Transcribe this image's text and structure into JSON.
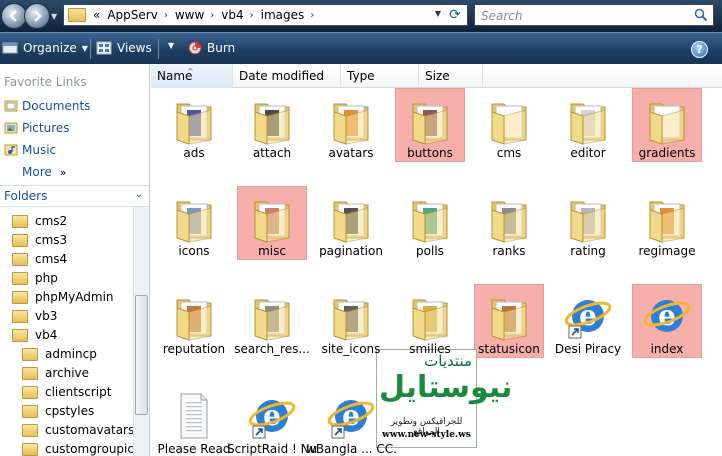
{
  "address": {
    "overflow": "«",
    "path": [
      "AppServ",
      "www",
      "vb4",
      "images"
    ]
  },
  "search": {
    "placeholder": "Search"
  },
  "commandbar": {
    "organize": "Organize",
    "views": "Views",
    "burn": "Burn",
    "help": "?"
  },
  "left": {
    "favorites_header": "Favorite Links",
    "favorites": [
      "Documents",
      "Pictures",
      "Music"
    ],
    "more": "More",
    "folders_header": "Folders",
    "tree": [
      {
        "label": "cms2",
        "level": 1
      },
      {
        "label": "cms3",
        "level": 1
      },
      {
        "label": "cms4",
        "level": 1
      },
      {
        "label": "php",
        "level": 1
      },
      {
        "label": "phpMyAdmin",
        "level": 1
      },
      {
        "label": "vb3",
        "level": 1
      },
      {
        "label": "vb4",
        "level": 1
      },
      {
        "label": "admincp",
        "level": 2
      },
      {
        "label": "archive",
        "level": 2
      },
      {
        "label": "clientscript",
        "level": 2
      },
      {
        "label": "cpstyles",
        "level": 2
      },
      {
        "label": "customavatars",
        "level": 2
      },
      {
        "label": "customgroupico",
        "level": 2
      }
    ]
  },
  "columns": [
    "Name",
    "Date modified",
    "Type",
    "Size"
  ],
  "items": [
    {
      "label": "ads",
      "kind": "folder",
      "selected": false,
      "preview": "#2a3ba6"
    },
    {
      "label": "attach",
      "kind": "folder",
      "selected": false,
      "preview": "#2a2a2a"
    },
    {
      "label": "avatars",
      "kind": "folder",
      "selected": false,
      "preview": "#e07a1c"
    },
    {
      "label": "buttons",
      "kind": "folder",
      "selected": true,
      "preview": "#7a3a3a"
    },
    {
      "label": "cms",
      "kind": "folder",
      "selected": false,
      "preview": ""
    },
    {
      "label": "editor",
      "kind": "folder",
      "selected": false,
      "preview": "#cccccc"
    },
    {
      "label": "gradients",
      "kind": "folder",
      "selected": true,
      "preview": ""
    },
    {
      "label": "icons",
      "kind": "folder",
      "selected": false,
      "preview": "#6b86b0"
    },
    {
      "label": "misc",
      "kind": "folder",
      "selected": true,
      "preview": "#c06a5a"
    },
    {
      "label": "pagination",
      "kind": "folder",
      "selected": false,
      "preview": "#333333"
    },
    {
      "label": "polls",
      "kind": "folder",
      "selected": false,
      "preview": "#2f9a6a"
    },
    {
      "label": "ranks",
      "kind": "folder",
      "selected": false,
      "preview": "#7a7a7a"
    },
    {
      "label": "rating",
      "kind": "folder",
      "selected": false,
      "preview": "#aaaaaa"
    },
    {
      "label": "regimage",
      "kind": "folder",
      "selected": false,
      "preview": "#e07a1c"
    },
    {
      "label": "reputation",
      "kind": "folder",
      "selected": false,
      "preview": "#c05a20"
    },
    {
      "label": "search_res...",
      "kind": "folder",
      "selected": false,
      "preview": "#777777"
    },
    {
      "label": "site_icons",
      "kind": "folder",
      "selected": false,
      "preview": "#444444"
    },
    {
      "label": "smilies",
      "kind": "folder",
      "selected": false,
      "preview": "#d0a020"
    },
    {
      "label": "statusicon",
      "kind": "folder",
      "selected": true,
      "preview": "#b05a20"
    },
    {
      "label": "Desi Piracy",
      "kind": "ie-shortcut",
      "selected": false
    },
    {
      "label": "index",
      "kind": "ie",
      "selected": true
    },
    {
      "label": "Please Read",
      "kind": "text",
      "selected": false
    },
    {
      "label": "ScriptRaid ! NullScripts",
      "kind": "ie-shortcut",
      "selected": false
    },
    {
      "label": "wBangla ... CC.com",
      "kind": "ie-shortcut",
      "selected": false
    }
  ],
  "watermark": {
    "top": "منتديات",
    "main": "نيوستايل",
    "sub": "للجرافيكس وتطوير المواقع",
    "url": "www.new-style.ws"
  }
}
